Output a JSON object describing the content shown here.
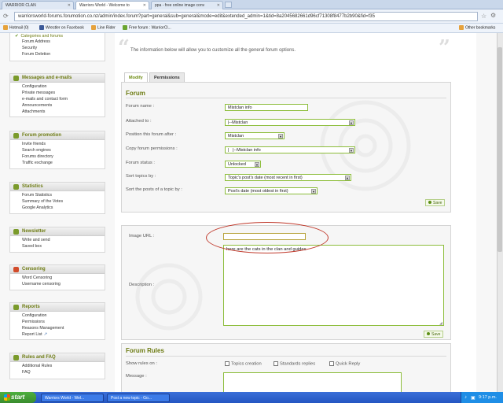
{
  "browser": {
    "tabs": [
      {
        "label": "WARRIOR CLAN",
        "active": false
      },
      {
        "label": "Warriors World - Welcome to",
        "active": true
      },
      {
        "label": "ppa - free online image conv",
        "active": false
      }
    ],
    "url": "warriorsworld-forums.forumotion.co.nz/admin/index.forum?part=general&sub=general&mode=edit&extended_admin=1&tid=8a2045682661d96cf71308f8477b2b90&fid=f35",
    "bookmarks": [
      "Hotmail (0)",
      "Wrestler on Facebook",
      "Line Rider",
      "Free forum : WarriorCl..."
    ],
    "other_bookmarks": "Other bookmarks"
  },
  "sidebar": {
    "top_items": [
      "Categories and forums",
      "Forum Address",
      "Security",
      "Forum Deletion"
    ],
    "sections": [
      {
        "title": "Messages and e-mails",
        "items": [
          "Configuration",
          "Private messages",
          "e-mails and contact form",
          "Announcements",
          "Attachments"
        ]
      },
      {
        "title": "Forum promotion",
        "items": [
          "Invite friends",
          "Search engines",
          "Forums directory",
          "Traffic exchange"
        ]
      },
      {
        "title": "Statistics",
        "items": [
          "Forum Statistics",
          "Summary of the Votes",
          "Google Analytics"
        ]
      },
      {
        "title": "Newsletter",
        "items": [
          "Write and send",
          "Saved box"
        ]
      },
      {
        "title": "Censoring",
        "items": [
          "Word Censoring",
          "Username censoring"
        ]
      },
      {
        "title": "Reports",
        "items": [
          "Configuration",
          "Permissions",
          "Reasons Management",
          "Report List"
        ]
      },
      {
        "title": "Rules and FAQ",
        "items": [
          "Additional Rules",
          "FAQ"
        ]
      }
    ]
  },
  "content": {
    "intro": "The information below will allow you to customize all the general forum options.",
    "tabs": [
      "Modify",
      "Permissions"
    ],
    "forum_panel": {
      "title": "Forum",
      "fields": [
        {
          "label": "Forum name :",
          "value": "Mistclan info",
          "kind": "input"
        },
        {
          "label": "Attached to :",
          "value": "|--Mistclan",
          "kind": "select"
        },
        {
          "label": "Position this forum after :",
          "value": "Mistclan",
          "kind": "select"
        },
        {
          "label": "Copy forum permissions :",
          "value": "|   |--Mistclan info",
          "kind": "select"
        },
        {
          "label": "Forum status :",
          "value": "Unlocked",
          "kind": "select"
        },
        {
          "label": "Sort topics by :",
          "value": "Topic's post's date (most recent in first)",
          "kind": "select"
        },
        {
          "label": "Sort the posts of a topic by :",
          "value": "Post's date (most oldest in first)",
          "kind": "select"
        }
      ],
      "save_label": "Save"
    },
    "image_panel": {
      "image_url_label": "Image URL :",
      "image_url_value": "",
      "description_label": "Description :",
      "description_value": "here are the cats in the clan and guides",
      "save_label": "Save"
    },
    "rules_panel": {
      "title": "Forum Rules",
      "show_rules_label": "Show rules on :",
      "checkboxes": [
        "Topics creation",
        "Standards replies",
        "Quick Reply"
      ],
      "message_label": "Message :"
    }
  },
  "taskbar": {
    "start_label": "start",
    "tasks": [
      "Warriors World - Wel...",
      "Post a new topic - Go..."
    ],
    "time": "9:17 p.m."
  },
  "colors": {
    "accent": "#6d7b12",
    "field_border": "#8cbd3a",
    "annotation": "#c0392b"
  }
}
